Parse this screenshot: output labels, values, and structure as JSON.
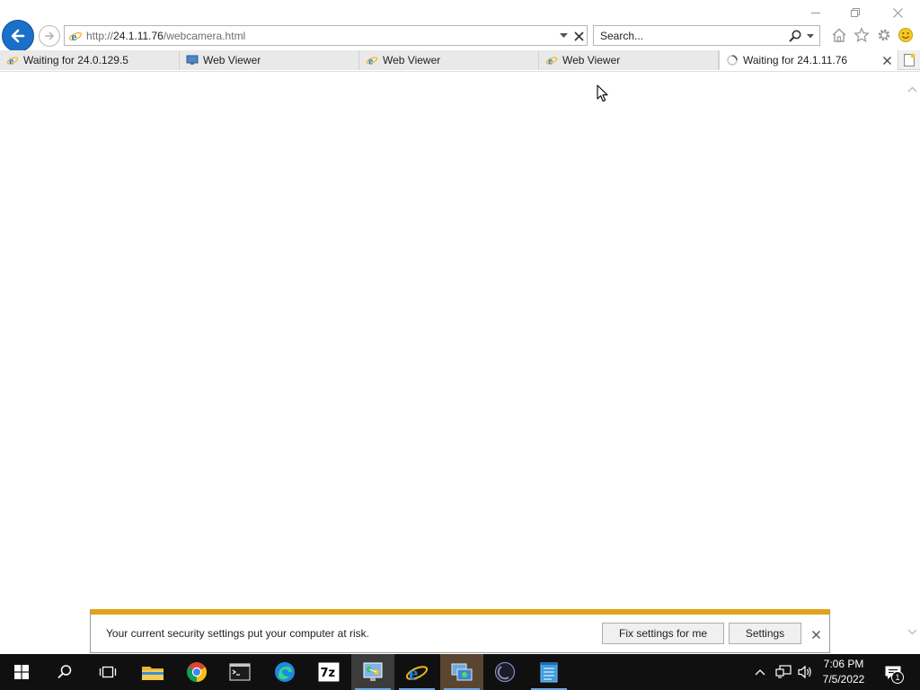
{
  "browser": {
    "address": {
      "protocol": "http://",
      "host": "24.1.11.76",
      "path": "/webcamera.html"
    },
    "search": {
      "placeholder": "Search..."
    }
  },
  "tabs": [
    {
      "label": "Waiting for 24.0.129.5",
      "icon": "ie-page-icon",
      "active": false
    },
    {
      "label": "Web Viewer",
      "icon": "web-viewer-icon",
      "active": false
    },
    {
      "label": "Web Viewer",
      "icon": "ie-page-icon",
      "active": false
    },
    {
      "label": "Web Viewer",
      "icon": "ie-page-icon",
      "active": false
    },
    {
      "label": "Waiting for 24.1.11.76",
      "icon": "loading-spinner-icon",
      "active": true
    }
  ],
  "notification": {
    "message": "Your current security settings put your computer at risk.",
    "fix_label": "Fix settings for me",
    "settings_label": "Settings"
  },
  "taskbar": {
    "apps": [
      "start",
      "search",
      "task-view",
      "file-explorer",
      "chrome",
      "command-prompt",
      "edge",
      "7-zip",
      "network-tool",
      "internet-explorer",
      "network-manager",
      "obs",
      "notepad"
    ],
    "clock_time": "7:06 PM",
    "clock_date": "7/5/2022",
    "notification_count": "1"
  },
  "colors": {
    "accent": "#1a6fc9",
    "warning_bar": "#e3a21a",
    "taskbar": "#101010"
  }
}
